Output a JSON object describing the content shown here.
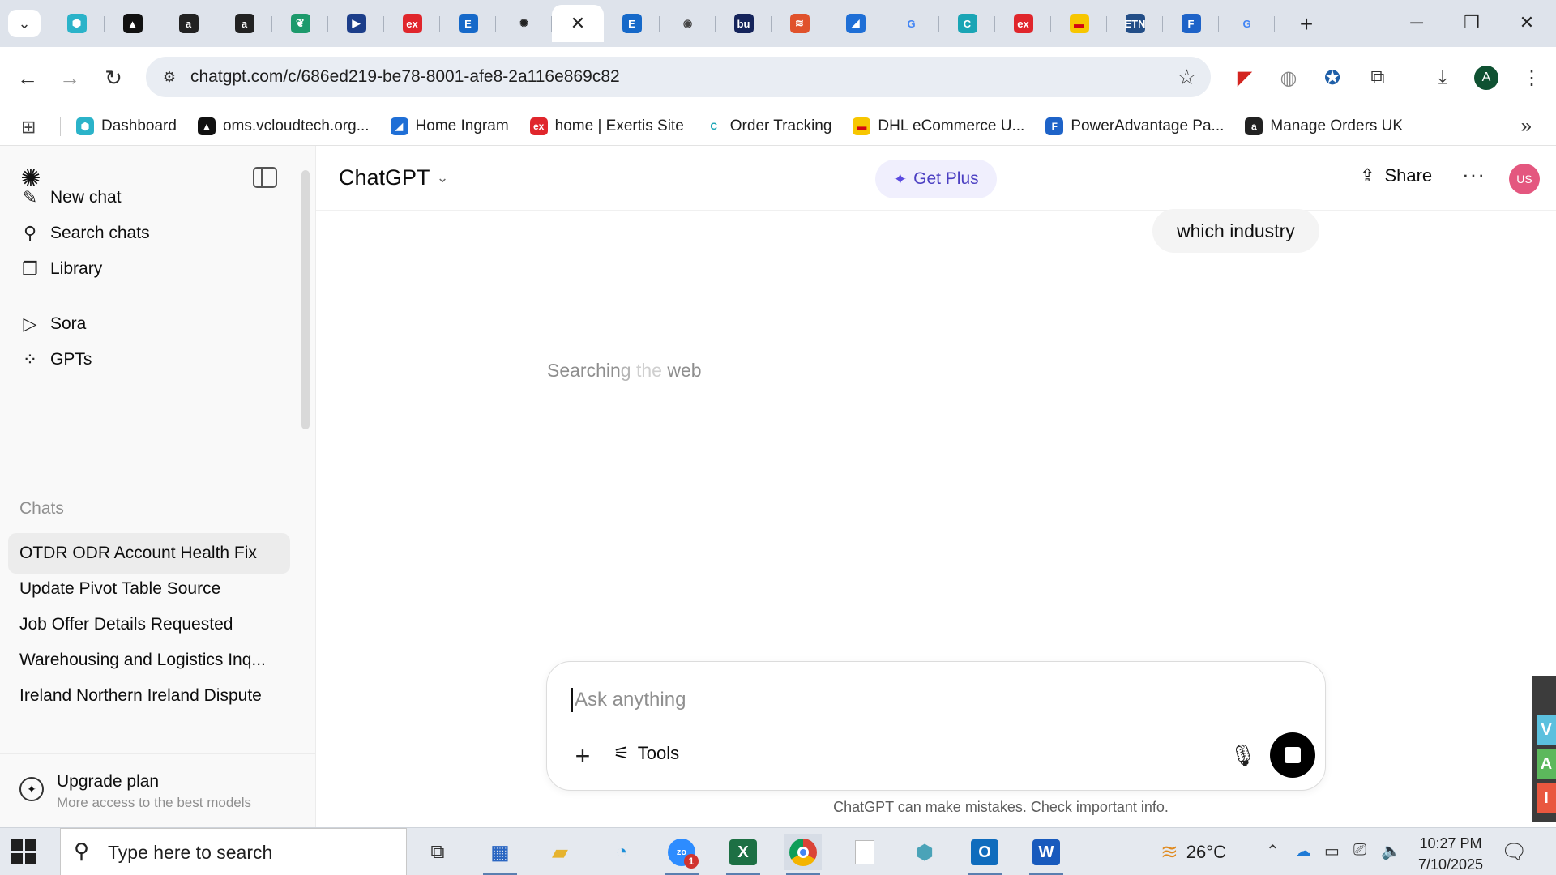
{
  "browser": {
    "tabs": [
      {
        "icon": "hexagon-icon",
        "color": "#2bb3c9",
        "glyph": "⬢"
      },
      {
        "icon": "triangle-logo-icon",
        "color": "#111111",
        "glyph": "▲"
      },
      {
        "icon": "amazon-icon",
        "color": "#222222",
        "glyph": "a"
      },
      {
        "icon": "amazon-icon",
        "color": "#222222",
        "glyph": "a"
      },
      {
        "icon": "leaf-icon",
        "color": "#1d9a6c",
        "glyph": "❦"
      },
      {
        "icon": "play-arrow-icon",
        "color": "#1c3e8a",
        "glyph": "▶"
      },
      {
        "icon": "exertis-icon",
        "color": "#e0262c",
        "glyph": "ex"
      },
      {
        "icon": "e-letter-icon",
        "color": "#1669c9",
        "glyph": "E"
      },
      {
        "icon": "chatgpt-icon",
        "color": "#222222",
        "glyph": "✺"
      },
      {
        "icon": "e-letter-icon",
        "color": "#1669c9",
        "glyph": "E"
      },
      {
        "icon": "lightbulb-icon",
        "color": "#444444",
        "glyph": "◉"
      },
      {
        "icon": "bu-logo-icon",
        "color": "#15245b",
        "glyph": "bu"
      },
      {
        "icon": "layers-icon",
        "color": "#e0522c",
        "glyph": "≋"
      },
      {
        "icon": "ingram-icon",
        "color": "#1f6fd6",
        "glyph": "◢"
      },
      {
        "icon": "google-icon",
        "color": "#4285f4",
        "glyph": "G"
      },
      {
        "icon": "c-circle-icon",
        "color": "#1aa5b5",
        "glyph": "C"
      },
      {
        "icon": "exertis-icon",
        "color": "#e0262c",
        "glyph": "ex"
      },
      {
        "icon": "dhl-icon",
        "color": "#f7c600",
        "glyph": "▬"
      },
      {
        "icon": "etn-icon",
        "color": "#234e87",
        "glyph": "ETN"
      },
      {
        "icon": "f-letter-icon",
        "color": "#1e63c8",
        "glyph": "F"
      },
      {
        "icon": "google-icon",
        "color": "#4285f4",
        "glyph": "G"
      }
    ],
    "url": "chatgpt.com/c/686ed219-be78-8001-afe8-2a116e869c82",
    "profile_initial": "A",
    "bookmarks": [
      {
        "label": "Dashboard",
        "icon": "hexagon-icon",
        "color": "#2bb3c9",
        "glyph": "⬢"
      },
      {
        "label": "oms.vcloudtech.org...",
        "icon": "triangle-logo-icon",
        "color": "#111111",
        "glyph": "▲"
      },
      {
        "label": "Home Ingram",
        "icon": "ingram-icon",
        "color": "#1f6fd6",
        "glyph": "◢"
      },
      {
        "label": "home | Exertis Site",
        "icon": "exertis-icon",
        "color": "#e0262c",
        "glyph": "ex"
      },
      {
        "label": "Order Tracking",
        "icon": "c-circle-icon",
        "color": "#1aa5b5",
        "glyph": "C"
      },
      {
        "label": "DHL eCommerce U...",
        "icon": "dhl-icon",
        "color": "#f7c600",
        "glyph": "▬"
      },
      {
        "label": "PowerAdvantage Pa...",
        "icon": "f-letter-icon",
        "color": "#1e63c8",
        "glyph": "F"
      },
      {
        "label": "Manage Orders UK",
        "icon": "amazon-icon",
        "color": "#222222",
        "glyph": "a"
      }
    ]
  },
  "sidebar": {
    "nav": [
      {
        "label": "New chat",
        "icon": "edit-icon",
        "glyph": "✎"
      },
      {
        "label": "Search chats",
        "icon": "search-icon",
        "glyph": "⚲"
      },
      {
        "label": "Library",
        "icon": "library-icon",
        "glyph": "❐"
      },
      {
        "label": "Sora",
        "icon": "play-circle-icon",
        "glyph": "▷"
      },
      {
        "label": "GPTs",
        "icon": "grid-icon",
        "glyph": "⁘"
      }
    ],
    "chats_heading": "Chats",
    "chats": [
      "OTDR ODR Account Health Fix",
      "Update Pivot Table Source",
      "Job Offer Details Requested",
      "Warehousing and Logistics Inq...",
      "Ireland Northern Ireland Dispute"
    ],
    "upgrade": {
      "title": "Upgrade plan",
      "subtitle": "More access to the best models"
    }
  },
  "main": {
    "model": "ChatGPT",
    "get_plus": "Get Plus",
    "share": "Share",
    "avatar": "US",
    "user_message": "which industry",
    "status_a": "Searchin",
    "status_b": "g",
    "status_c": "the",
    "status_d": "web",
    "composer_placeholder": "Ask anything",
    "tools_label": "Tools",
    "disclaimer": "ChatGPT can make mistakes. Check important info."
  },
  "taskbar": {
    "search_placeholder": "Type here to search",
    "zoom_badge": "1",
    "temperature": "26°C",
    "time": "10:27 PM",
    "date": "7/10/2025"
  },
  "colors": {
    "accent_purple": "#4b3fc2",
    "avatar_pink": "#e4577f",
    "excel_green": "#1d7044",
    "outlook_blue": "#0f6cbd",
    "word_blue": "#185abd"
  }
}
